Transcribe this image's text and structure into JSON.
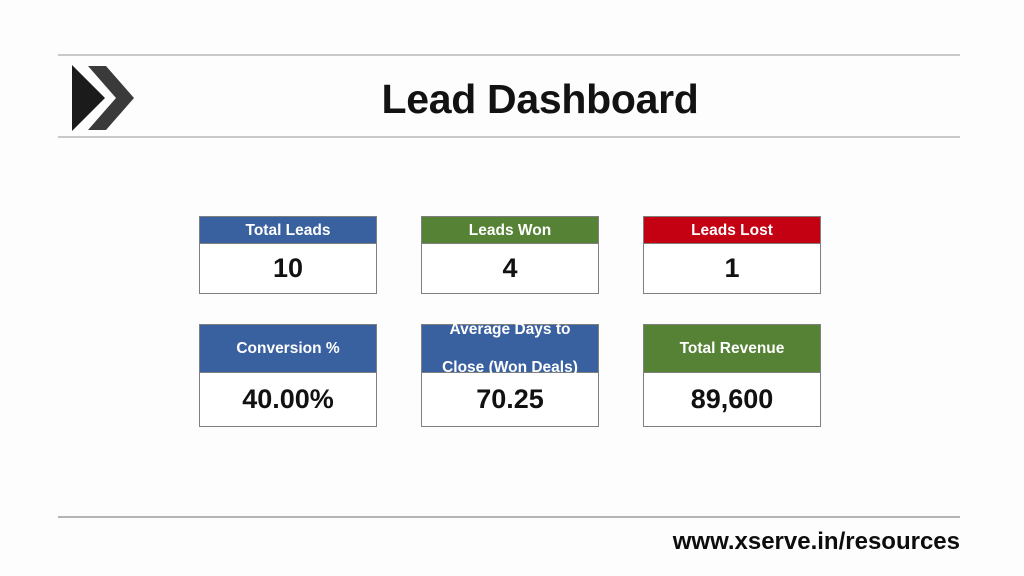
{
  "header": {
    "title": "Lead Dashboard",
    "logo_icon": "xserve-play-x-logo-icon"
  },
  "cards": [
    {
      "label": "Total Leads",
      "value": "10",
      "color": "#39609f",
      "accent": "blue"
    },
    {
      "label": "Leads Won",
      "value": "4",
      "color": "#558234",
      "accent": "green"
    },
    {
      "label": "Leads Lost",
      "value": "1",
      "color": "#c40013",
      "accent": "red"
    },
    {
      "label": "Conversion %",
      "value": "40.00%",
      "color": "#39609f",
      "accent": "blue"
    },
    {
      "label_line1": "Average Days to",
      "label_line2": "Close (Won Deals)",
      "value": "70.25",
      "color": "#39609f",
      "accent": "blue"
    },
    {
      "label": "Total Revenue",
      "value": "89,600",
      "color": "#558234",
      "accent": "green"
    }
  ],
  "footer": {
    "url": "www.xserve.in/resources"
  },
  "colors": {
    "blue": "#39609f",
    "green": "#558234",
    "red": "#c40013",
    "rule": "#c9c9c9",
    "text": "#111111",
    "background": "#fdfdfd"
  }
}
